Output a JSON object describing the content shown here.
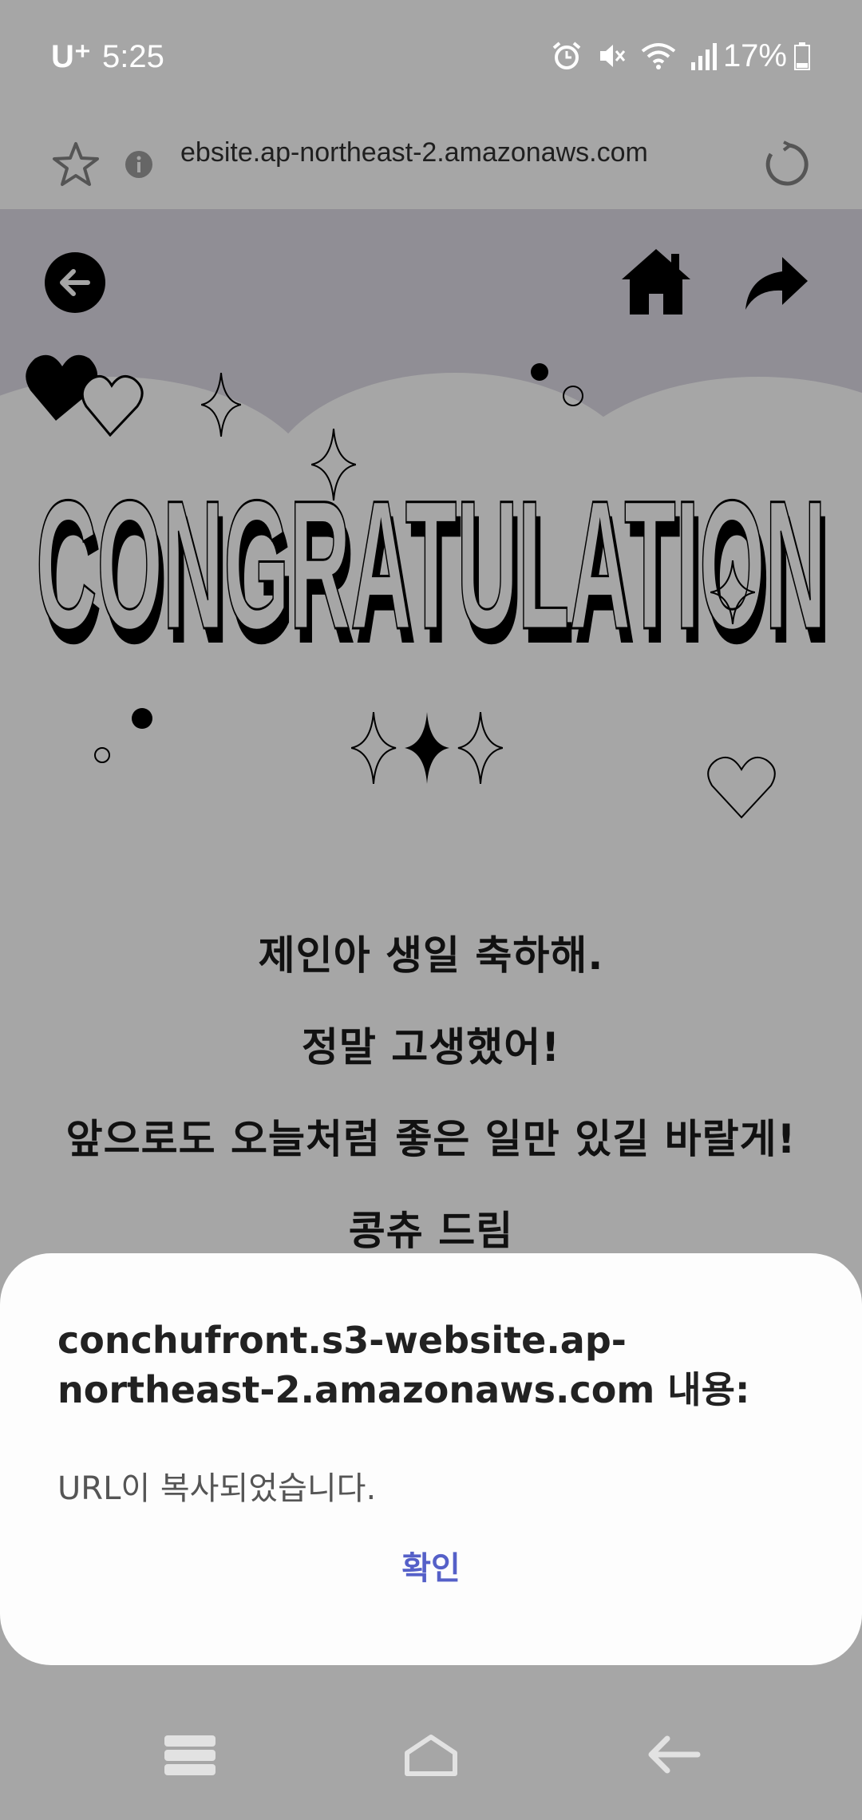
{
  "status_bar": {
    "carrier": "U⁺",
    "time": "5:25",
    "battery": "17%"
  },
  "browser": {
    "url": "ebsite.ap-northeast-2.amazonaws.com"
  },
  "page": {
    "title_art": "CONGRATULATION",
    "messages": [
      "제인아 생일 축하해.",
      "정말 고생했어!",
      "앞으로도 오늘처럼 좋은 일만 있길 바랄게!",
      "콩츄 드림"
    ]
  },
  "dialog": {
    "title": "conchufront.s3-website.ap-northeast-2.amazonaws.com 내용:",
    "body": "URL이 복사되었습니다.",
    "confirm_label": "확인"
  },
  "colors": {
    "accent": "#5560c8",
    "page_bg": "#a6a6a6",
    "header_bg": "#908e95"
  }
}
